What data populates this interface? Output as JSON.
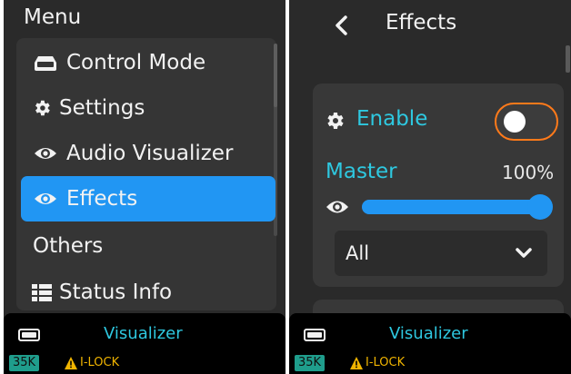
{
  "left_screen": {
    "title": "Menu",
    "items": [
      {
        "label": "Control Mode",
        "icon": "controller-icon",
        "active": false
      },
      {
        "label": "Settings",
        "icon": "gear-icon",
        "active": false
      },
      {
        "label": "Audio Visualizer",
        "icon": "eye-icon",
        "active": false
      },
      {
        "label": "Effects",
        "icon": "eye-icon",
        "active": true
      },
      {
        "label": "Others",
        "icon": "",
        "active": false
      },
      {
        "label": "Status Info",
        "icon": "list-icon",
        "active": false
      }
    ]
  },
  "right_screen": {
    "title": "Effects",
    "enable_label": "Enable",
    "enable_on": false,
    "master_label": "Master",
    "master_value": "100%",
    "master_level": 1.0,
    "dropdown_value": "All"
  },
  "status_bar": {
    "mode": "Visualizer",
    "badge": "35K",
    "lock": "I-LOCK"
  },
  "colors": {
    "accent": "#2196f3",
    "cyan_label": "#2ec8e0",
    "toggle_focus": "#ff7a1a",
    "warning": "#f0b400",
    "badge": "#1f9d8c"
  }
}
